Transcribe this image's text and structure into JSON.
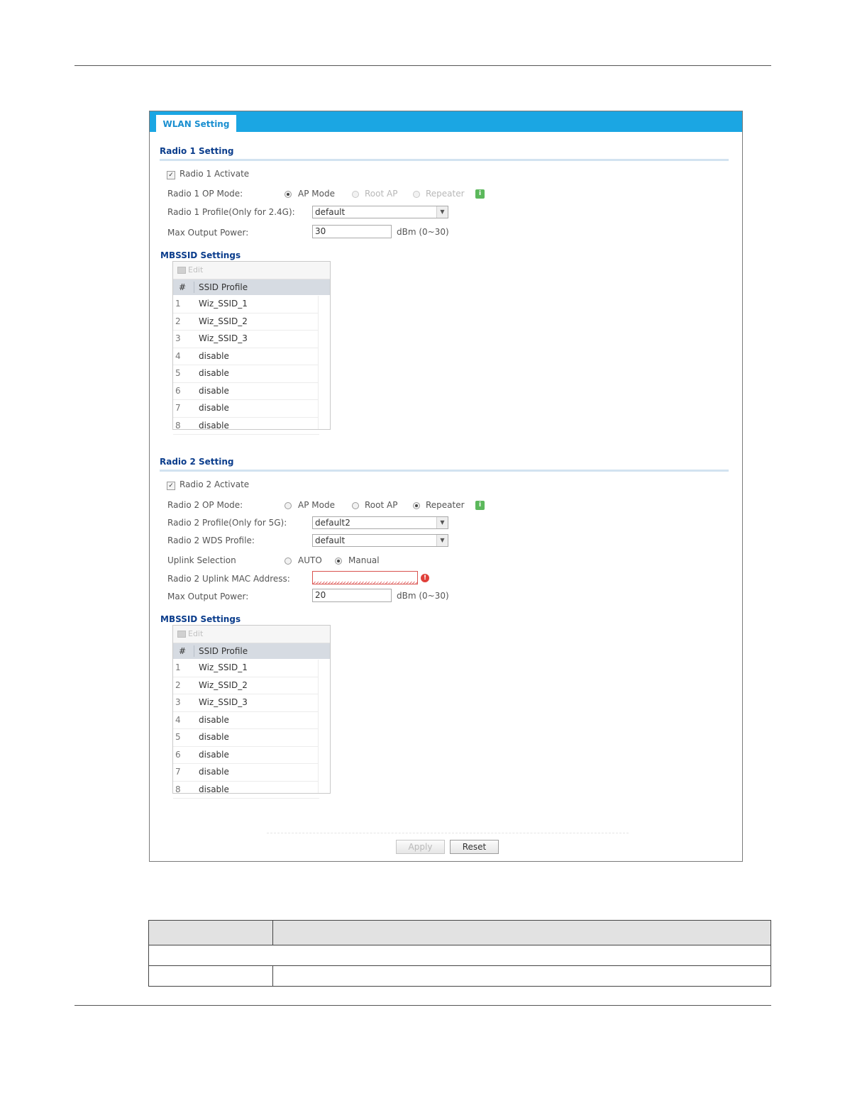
{
  "panel": {
    "tab_label": "WLAN Setting",
    "radio1": {
      "section_title": "Radio 1 Setting",
      "activate_label": "Radio 1 Activate",
      "activate_checked": true,
      "op_mode_label": "Radio 1 OP Mode:",
      "op_modes": [
        "AP Mode",
        "Root AP",
        "Repeater"
      ],
      "op_mode_selected": "AP Mode",
      "profile_label": "Radio 1 Profile(Only for 2.4G):",
      "profile_value": "default",
      "power_label": "Max Output Power:",
      "power_value": "30",
      "power_unit": "dBm (0~30)",
      "mbssid": {
        "title": "MBSSID Settings",
        "edit_label": "Edit",
        "col_num": "#",
        "col_profile": "SSID Profile",
        "rows": [
          {
            "n": "1",
            "v": "Wiz_SSID_1"
          },
          {
            "n": "2",
            "v": "Wiz_SSID_2"
          },
          {
            "n": "3",
            "v": "Wiz_SSID_3"
          },
          {
            "n": "4",
            "v": "disable"
          },
          {
            "n": "5",
            "v": "disable"
          },
          {
            "n": "6",
            "v": "disable"
          },
          {
            "n": "7",
            "v": "disable"
          },
          {
            "n": "8",
            "v": "disable"
          }
        ]
      }
    },
    "radio2": {
      "section_title": "Radio 2 Setting",
      "activate_label": "Radio 2 Activate",
      "activate_checked": true,
      "op_mode_label": "Radio 2 OP Mode:",
      "op_modes": [
        "AP Mode",
        "Root AP",
        "Repeater"
      ],
      "op_mode_selected": "Repeater",
      "profile_label": "Radio 2 Profile(Only for 5G):",
      "profile_value": "default2",
      "wds_label": "Radio 2 WDS Profile:",
      "wds_value": "default",
      "uplink_label": "Uplink Selection",
      "uplink_options": [
        "AUTO",
        "Manual"
      ],
      "uplink_selected": "Manual",
      "mac_label": "Radio 2 Uplink MAC Address:",
      "mac_value": "",
      "power_label": "Max Output Power:",
      "power_value": "20",
      "power_unit": "dBm (0~30)",
      "mbssid": {
        "title": "MBSSID Settings",
        "edit_label": "Edit",
        "col_num": "#",
        "col_profile": "SSID Profile",
        "rows": [
          {
            "n": "1",
            "v": "Wiz_SSID_1"
          },
          {
            "n": "2",
            "v": "Wiz_SSID_2"
          },
          {
            "n": "3",
            "v": "Wiz_SSID_3"
          },
          {
            "n": "4",
            "v": "disable"
          },
          {
            "n": "5",
            "v": "disable"
          },
          {
            "n": "6",
            "v": "disable"
          },
          {
            "n": "7",
            "v": "disable"
          },
          {
            "n": "8",
            "v": "disable"
          }
        ]
      }
    },
    "buttons": {
      "apply": "Apply",
      "reset": "Reset"
    }
  },
  "icons": {
    "info": "info-icon",
    "warning": "warning-icon",
    "dropdown": "chevron-down-icon",
    "edit": "edit-icon"
  },
  "colors": {
    "tab_bar": "#1ba6e3",
    "section_title": "#0b3d8c",
    "info": "#5cb85c",
    "warning": "#e0403a"
  }
}
